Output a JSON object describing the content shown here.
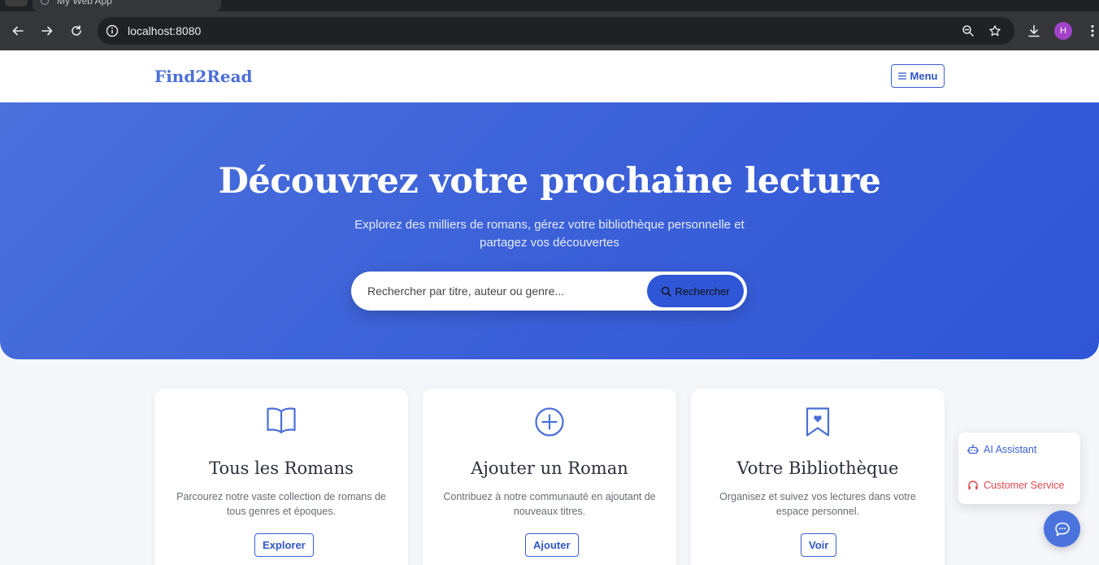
{
  "browser": {
    "tab_title": "My Web App",
    "url": "localhost:8080",
    "profile_initial": "H"
  },
  "header": {
    "logo": "Find2Read",
    "menu_label": "Menu"
  },
  "hero": {
    "title": "Découvrez votre prochaine lecture",
    "subtitle": "Explorez des milliers de romans, gérez votre bibliothèque personnelle et partagez vos découvertes",
    "search_placeholder": "Rechercher par titre, auteur ou genre...",
    "search_button": "Rechercher"
  },
  "cards": [
    {
      "icon": "book-open-icon",
      "title": "Tous les Romans",
      "description": "Parcourez notre vaste collection de romans de tous genres et époques.",
      "button": "Explorer"
    },
    {
      "icon": "plus-circle-icon",
      "title": "Ajouter un Roman",
      "description": "Contribuez à notre communauté en ajoutant de nouveaux titres.",
      "button": "Ajouter"
    },
    {
      "icon": "bookmark-heart-icon",
      "title": "Votre Bibliothèque",
      "description": "Organisez et suivez vos lectures dans votre espace personnel.",
      "button": "Voir"
    }
  ],
  "chat": {
    "ai_assistant": "AI Assistant",
    "customer_service": "Customer Service"
  },
  "colors": {
    "brand": "#4a6fd8",
    "hero_gradient_start": "#4a71dc",
    "hero_gradient_end": "#2f56d6",
    "button_primary": "#2f56d6",
    "ai_assistant": "#3b5fd6",
    "customer_service": "#e5484d"
  }
}
